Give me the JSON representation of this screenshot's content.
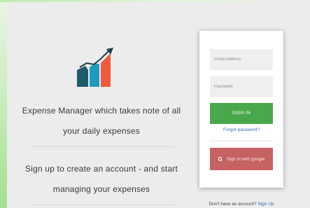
{
  "left_panel": {
    "tagline_line1": "Expense Manager which takes note of all",
    "tagline_line2": "your daily expenses",
    "signup_line1": "Sign up to create an account - and start",
    "signup_line2": "managing your expenses"
  },
  "login_card": {
    "email_placeholder": "Email Address",
    "password_placeholder": "Password",
    "signin_label": "SIGN IN",
    "forgot_label": "Forgot password?",
    "google_icon": "G",
    "google_label": "Sign in with google"
  },
  "footer": {
    "no_account_text": "Don't have an account?",
    "signup_link": "Sign Up"
  },
  "colors": {
    "signin_button": "#4aa84c",
    "google_button": "#c76262",
    "link": "#2d6fbf",
    "logo_dark": "#1f5a6b",
    "logo_teal": "#1f9ac0",
    "logo_orange": "#f25a3c"
  }
}
